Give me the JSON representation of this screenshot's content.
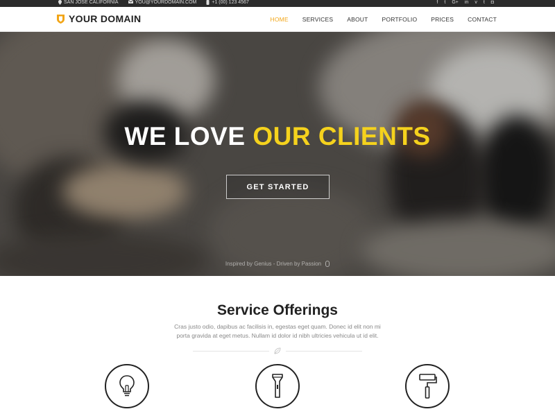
{
  "topbar": {
    "address": "SAN JOSE CALIFORNIA",
    "email": "YOU@YOURDOMAIN.COM",
    "phone": "+1 (00) 123 4567",
    "social_icons": [
      "facebook-icon",
      "twitter-icon",
      "google-plus-icon",
      "linkedin-icon",
      "vimeo-icon",
      "tumblr-icon",
      "instagram-icon"
    ]
  },
  "brand": {
    "name": "YOUR DOMAIN",
    "accent_color": "#f2a516"
  },
  "nav": {
    "items": [
      {
        "label": "HOME",
        "active": true
      },
      {
        "label": "SERVICES",
        "active": false
      },
      {
        "label": "ABOUT",
        "active": false
      },
      {
        "label": "PORTFOLIO",
        "active": false
      },
      {
        "label": "PRICES",
        "active": false
      },
      {
        "label": "CONTACT",
        "active": false
      }
    ]
  },
  "hero": {
    "title_part1": "WE LOVE",
    "title_part2": "OUR CLIENTS",
    "highlight_color": "#f5d21d",
    "button_label": "GET STARTED",
    "tagline": "Inspired by Genius - Driven by Passion"
  },
  "services": {
    "heading": "Service Offerings",
    "description": "Cras justo odio, dapibus ac facilisis in, egestas eget quam. Donec id elit non mi porta gravida at eget metus. Nullam id dolor id nibh ultricies vehicula ut id elit.",
    "icons": [
      "lightbulb-icon",
      "flashlight-icon",
      "paint-roller-icon"
    ]
  }
}
